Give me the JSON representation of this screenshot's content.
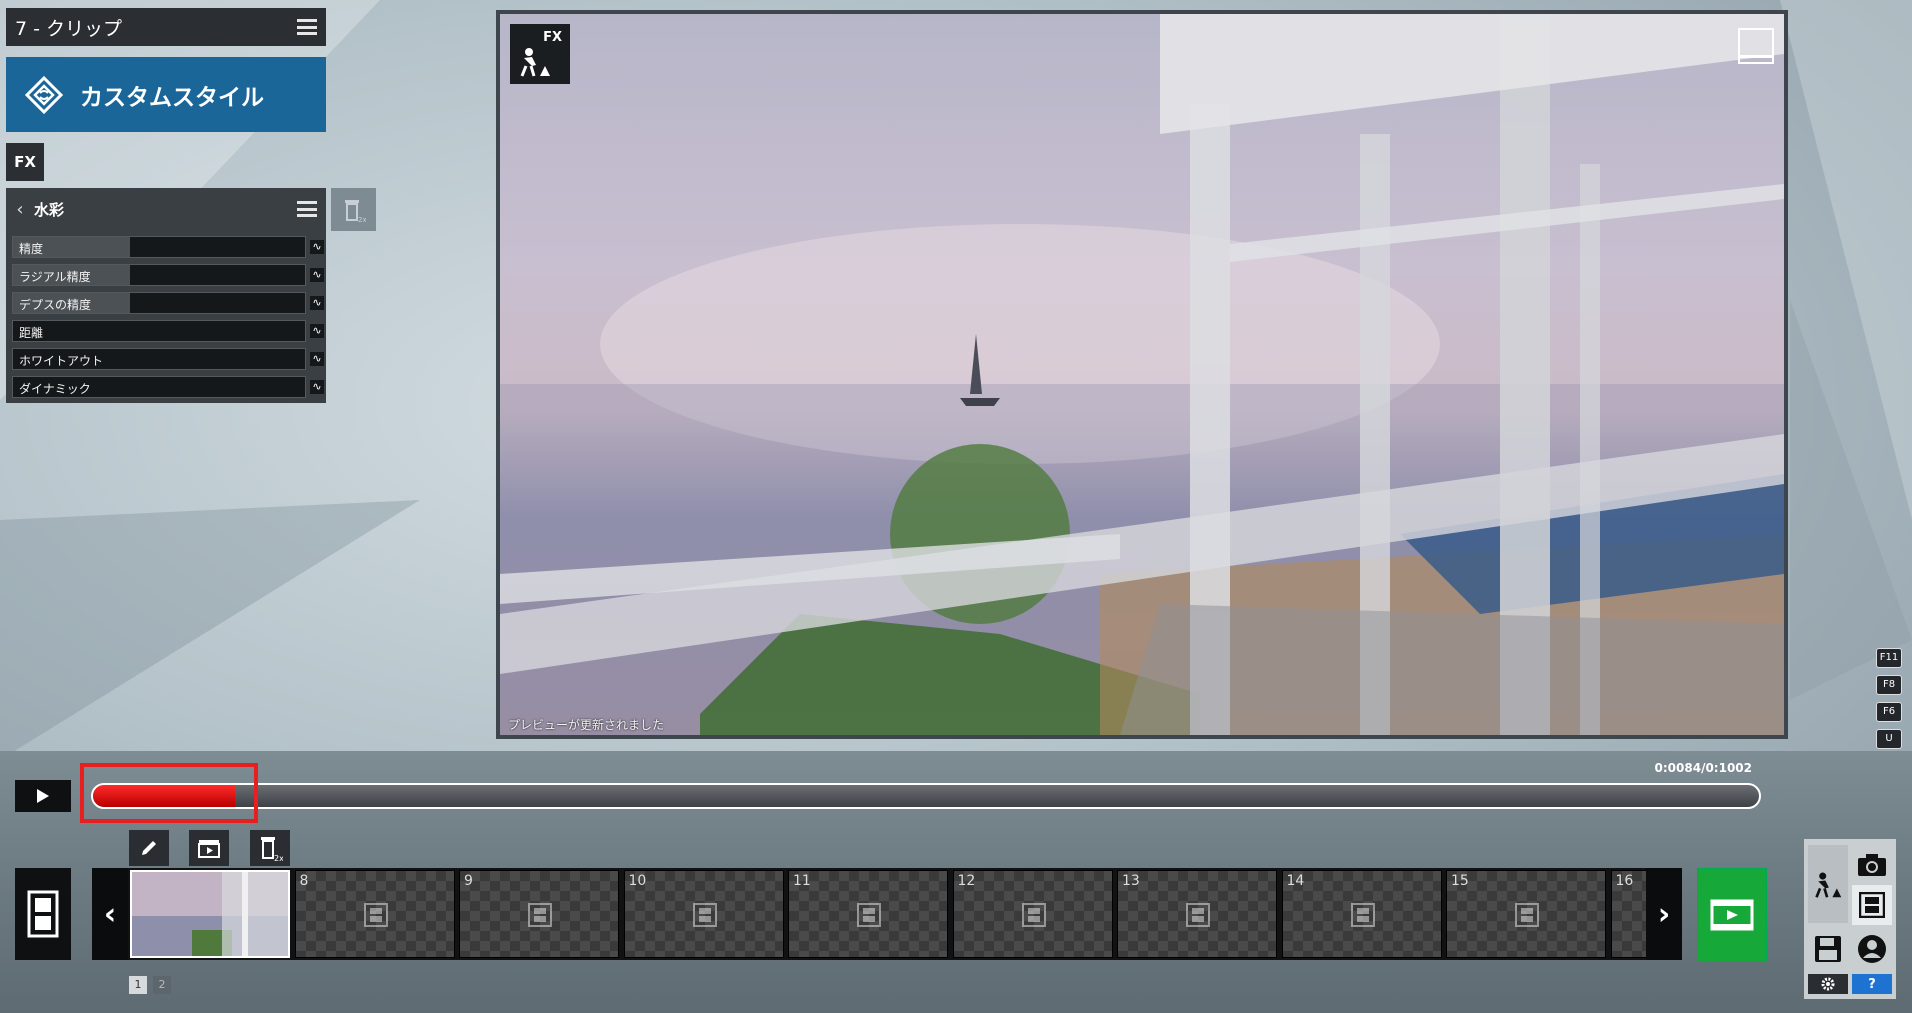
{
  "clip": {
    "title": "7 - クリップ"
  },
  "style_button": {
    "label": "カスタムスタイル"
  },
  "fx_button": {
    "label": "FX"
  },
  "effect": {
    "name": "水彩",
    "params": [
      {
        "label": "精度",
        "level": 0.4
      },
      {
        "label": "ラジアル精度",
        "level": 0.4
      },
      {
        "label": "デプスの精度",
        "level": 0.4
      },
      {
        "label": "距離",
        "level": 0.0
      },
      {
        "label": "ホワイトアウト",
        "level": 0.0
      },
      {
        "label": "ダイナミック",
        "level": 0.0
      }
    ],
    "wave_glyph": "∿"
  },
  "preview": {
    "fx_badge": "FX",
    "status": "プレビューが更新されました"
  },
  "hotkeys": [
    "F11",
    "F8",
    "F6",
    "U"
  ],
  "playback": {
    "time_display": "0:0084/0:1002",
    "progress": 0.085
  },
  "clip_strip": {
    "slots": [
      "",
      "8",
      "9",
      "10",
      "11",
      "12",
      "13",
      "14",
      "15",
      "16"
    ]
  },
  "pager": [
    "1",
    "2"
  ],
  "side_panel": {
    "help_label": "?"
  },
  "colors": {
    "accent_blue": "#1a6699",
    "progress_red": "#e60000",
    "go_green": "#17a83a",
    "help_blue": "#1e73d2"
  }
}
